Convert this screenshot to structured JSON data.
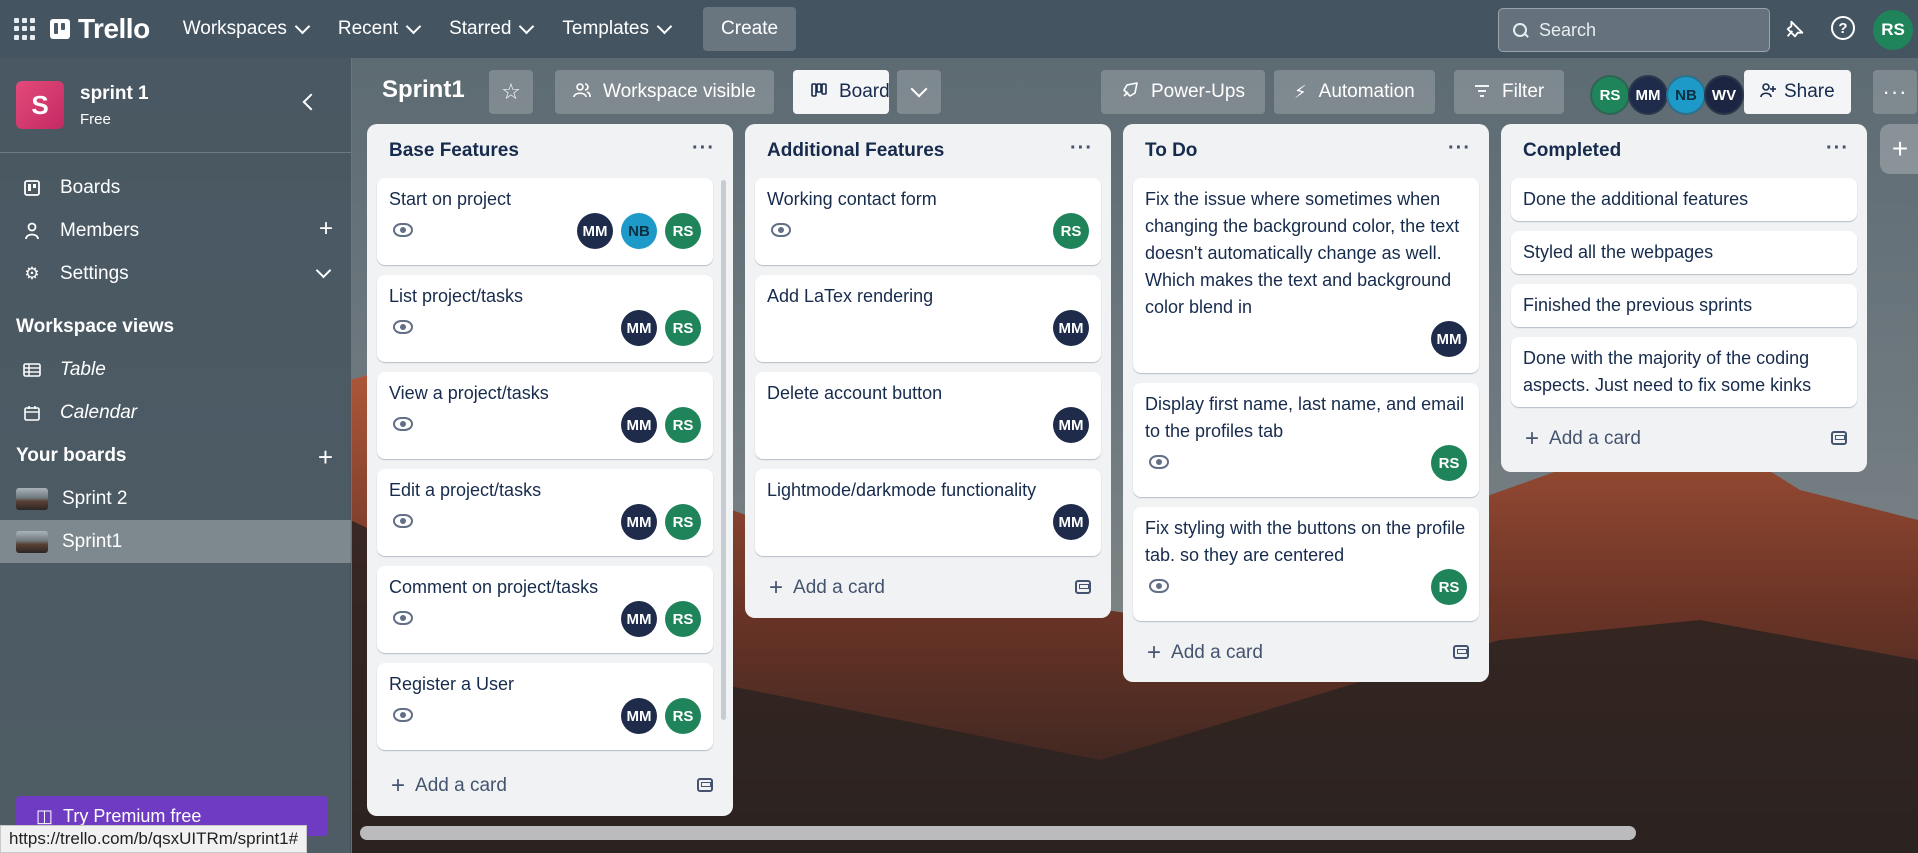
{
  "nav": {
    "brand": "Trello",
    "menu": [
      {
        "label": "Workspaces"
      },
      {
        "label": "Recent"
      },
      {
        "label": "Starred"
      },
      {
        "label": "Templates"
      }
    ],
    "create_label": "Create",
    "search_placeholder": "Search",
    "user_initials": "RS"
  },
  "sidebar": {
    "workspace_initial": "S",
    "workspace_name": "sprint 1",
    "workspace_plan": "Free",
    "items": [
      {
        "label": "Boards"
      },
      {
        "label": "Members"
      },
      {
        "label": "Settings"
      }
    ],
    "views_heading": "Workspace views",
    "views": [
      {
        "label": "Table"
      },
      {
        "label": "Calendar"
      }
    ],
    "boards_heading": "Your boards",
    "boards": [
      {
        "label": "Sprint 2"
      },
      {
        "label": "Sprint1"
      }
    ],
    "premium_label": "Try Premium free"
  },
  "board": {
    "title": "Sprint1",
    "visibility_label": "Workspace visible",
    "view_label": "Board",
    "powerups_label": "Power-Ups",
    "automation_label": "Automation",
    "filter_label": "Filter",
    "share_label": "Share",
    "members": [
      "RS",
      "MM",
      "NB",
      "WV"
    ]
  },
  "lists": [
    {
      "title": "Base Features",
      "cards": [
        {
          "title": "Start on project",
          "members": [
            "MM",
            "NB",
            "RS"
          ]
        },
        {
          "title": "List project/tasks",
          "members": [
            "MM",
            "RS"
          ]
        },
        {
          "title": "View a project/tasks",
          "members": [
            "MM",
            "RS"
          ]
        },
        {
          "title": "Edit a project/tasks",
          "members": [
            "MM",
            "RS"
          ]
        },
        {
          "title": "Comment on project/tasks",
          "members": [
            "MM",
            "RS"
          ]
        },
        {
          "title": "Register a User",
          "members": [
            "MM",
            "RS"
          ]
        }
      ],
      "add_label": "Add a card"
    },
    {
      "title": "Additional Features",
      "cards": [
        {
          "title": "Working contact form",
          "members": [
            "RS"
          ]
        },
        {
          "title": "Add LaTex rendering",
          "members": [
            "MM"
          ]
        },
        {
          "title": "Delete account button",
          "members": [
            "MM"
          ]
        },
        {
          "title": "Lightmode/darkmode functionality",
          "members": [
            "MM"
          ]
        }
      ],
      "add_label": "Add a card"
    },
    {
      "title": "To Do",
      "cards": [
        {
          "title": "Fix the issue where sometimes when changing the background color, the text doesn't automatically change as well. Which makes the text and background color blend in",
          "members": [
            "MM"
          ]
        },
        {
          "title": "Display first name, last name, and email to the profiles tab",
          "members": [
            "RS"
          ]
        },
        {
          "title": "Fix styling with the buttons on the profile tab. so they are centered",
          "members": [
            "RS"
          ]
        }
      ],
      "add_label": "Add a card"
    },
    {
      "title": "Completed",
      "cards": [
        {
          "title": "Done the additional features"
        },
        {
          "title": "Styled all the webpages"
        },
        {
          "title": "Finished the previous sprints"
        },
        {
          "title": "Done with the majority of the coding aspects. Just need to fix some kinks"
        }
      ],
      "add_label": "Add a card"
    }
  ],
  "status_url": "https://trello.com/b/qsxUITRm/sprint1#",
  "colors": {
    "rs": "#1f845a",
    "mm": "#1e2b4a",
    "nb": "#1d9ac7",
    "wv": "#1c2541",
    "premium": "#6e3bc2"
  }
}
